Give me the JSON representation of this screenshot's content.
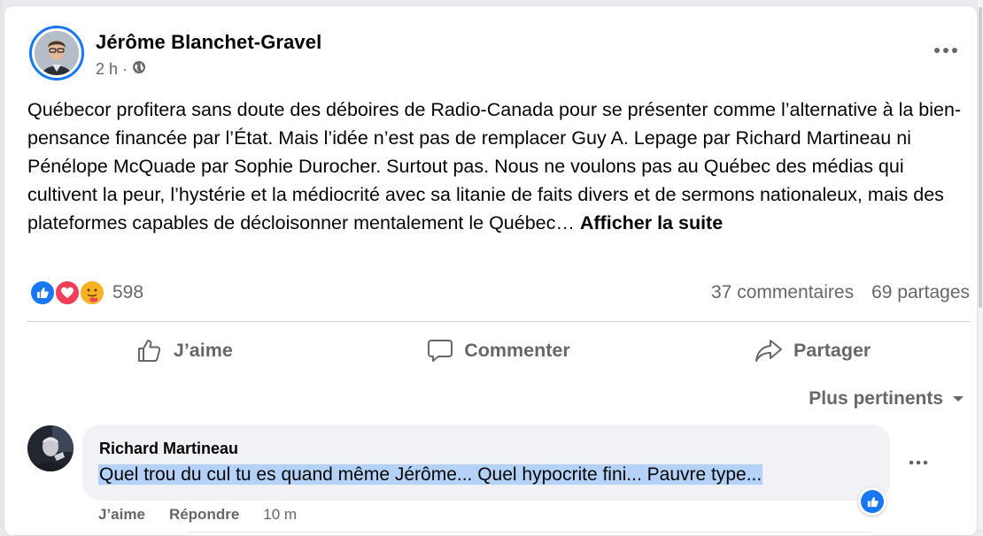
{
  "post": {
    "author": "Jérôme Blanchet-Gravel",
    "time": "2 h",
    "separator": "·",
    "text": "Québecor profitera sans doute des déboires de Radio-Canada pour se présenter comme l’alternative à la bien-pensance financée par l’État. Mais l’idée n’est pas de remplacer Guy A. Lepage par Richard Martineau ni Pénélope McQuade par Sophie Durocher. Surtout pas. Nous ne voulons pas au Québec des médias qui cultivent la peur, l’hystérie et la médiocrité avec sa litanie de faits divers et de sermons nationaleux, mais des plateformes capables de décloisonner mentalement le Québec…",
    "see_more": "Afficher la suite",
    "privacy_icon": "globe-icon",
    "more_icon": "more-horizontal-icon"
  },
  "stats": {
    "reactions": [
      "like",
      "love",
      "care"
    ],
    "reaction_count": "598",
    "comments": "37 commentaires",
    "shares": "69 partages"
  },
  "actions": {
    "like": "J’aime",
    "comment": "Commenter",
    "share": "Partager"
  },
  "sort": {
    "label": "Plus pertinents"
  },
  "comment": {
    "author": "Richard Martineau",
    "text": "Quel trou du cul tu es quand même Jérôme... Quel hypocrite fini... Pauvre type...",
    "like": "J’aime",
    "reply": "Répondre",
    "time": "10 m"
  },
  "colors": {
    "accent": "#1877f2",
    "love": "#f33e58",
    "care": "#f7b125",
    "secondary_text": "#65676b",
    "selection": "#b4d2f7"
  }
}
